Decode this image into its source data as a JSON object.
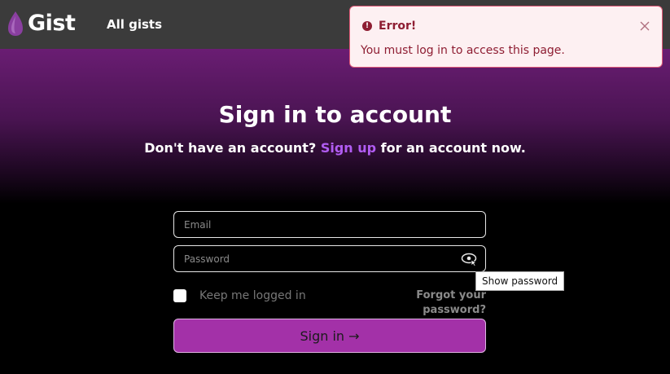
{
  "header": {
    "logo_text": "Gist",
    "nav_all_gists": "All gists"
  },
  "hero": {
    "title": "Sign in to account",
    "subtitle_prefix": "Don't have an account? ",
    "signup_link": "Sign up",
    "subtitle_suffix": " for an account now."
  },
  "form": {
    "email_placeholder": "Email",
    "password_placeholder": "Password",
    "show_password_tooltip": "Show password",
    "remember_label": "Keep me logged in",
    "forgot_link": "Forgot your password?",
    "signin_button": "Sign in →"
  },
  "toast": {
    "title": "Error!",
    "message": "You must log in to access this page."
  },
  "colors": {
    "brand_purple": "#a331a8",
    "link_purple": "#b15cf2",
    "error_text": "#8e1d32",
    "error_bg": "#fdf0f2"
  }
}
